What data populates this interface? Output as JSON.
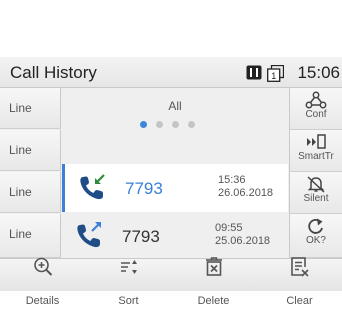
{
  "header": {
    "title": "Call History",
    "time": "15:06",
    "status_icons": [
      "message-icon",
      "line-1-icon"
    ]
  },
  "linekeys": [
    {
      "label": "Line"
    },
    {
      "label": "Line"
    },
    {
      "label": "Line"
    },
    {
      "label": "Line"
    }
  ],
  "filter": {
    "label": "All",
    "pages": 4,
    "active_page": 1
  },
  "calls": [
    {
      "number": "7793",
      "time": "15:36",
      "date": "26.06.2018",
      "type": "incoming",
      "selected": true
    },
    {
      "number": "7793",
      "time": "09:55",
      "date": "25.06.2018",
      "type": "outgoing",
      "selected": false
    }
  ],
  "softkeys": [
    {
      "label": "Conf",
      "icon": "conference-icon"
    },
    {
      "label": "SmartTr",
      "icon": "smart-transfer-icon"
    },
    {
      "label": "Silent",
      "icon": "silent-bell-icon"
    },
    {
      "label": "OK?",
      "icon": "refresh-icon"
    }
  ],
  "bottom": [
    {
      "label": "Details",
      "icon": "zoom-in-icon"
    },
    {
      "label": "Sort",
      "icon": "sort-icon"
    },
    {
      "label": "Delete",
      "icon": "delete-icon"
    },
    {
      "label": "Clear",
      "icon": "clear-icon"
    }
  ],
  "colors": {
    "accent": "#3a80d9",
    "call_icon": "#1f4e86",
    "incoming_arrow": "#2e8b3a",
    "outgoing_arrow": "#3a80d9"
  }
}
